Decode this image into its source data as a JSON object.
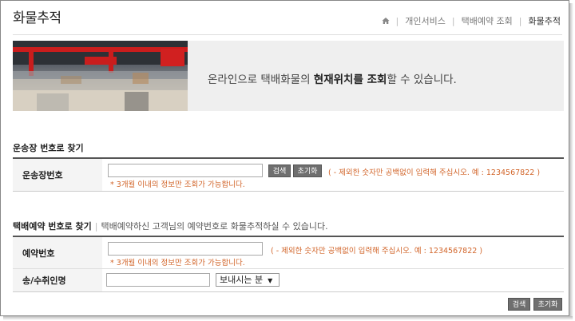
{
  "page": {
    "title": "화물추적"
  },
  "breadcrumb": {
    "items": [
      "개인서비스",
      "택배예약 조회"
    ],
    "current": "화물추적"
  },
  "banner": {
    "text_before": "온라인으로 택배화물의 ",
    "text_bold": "현재위치를 조회",
    "text_after": "할 수 있습니다."
  },
  "waybill": {
    "section_title": "운송장 번호로 찾기",
    "label": "운송장번호",
    "input_value": "",
    "search_label": "검색",
    "reset_label": "초기화",
    "hint": "( - 제외한 숫자만 공백없이 입력해 주십시오. 예 : 1234567822 )",
    "note": "* 3개월 이내의 정보만 조회가 가능합니다."
  },
  "reservation": {
    "section_title": "택배예약 번호로 찾기",
    "section_desc": "택배예약하신 고객님의 예약번호로 화물추적하실 수 있습니다.",
    "label": "예약번호",
    "input_value": "",
    "hint": "( - 제외한 숫자만 공백없이 입력해 주십시오. 예 : 1234567822 )",
    "note": "* 3개월 이내의 정보만 조회가 가능합니다.",
    "name_label": "송/수취인명",
    "name_value": "",
    "sender_select": "보내시는 분",
    "search_label": "검색",
    "reset_label": "초기화"
  }
}
